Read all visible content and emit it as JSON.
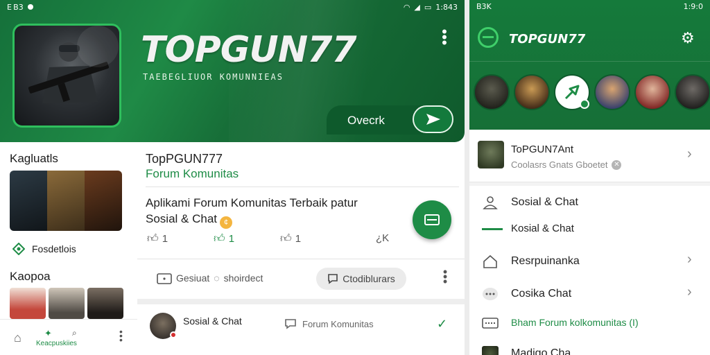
{
  "left": {
    "status_left": "E B3",
    "status_right": "1:843",
    "app_title": "TOPGUN77",
    "app_subtitle": "TAEBEGLIUOR KOMUNNIEAS",
    "cta_label": "Ovecrk",
    "sidebar": {
      "section1_title": "Kagluatls",
      "favorites_label": "Fosdetlois",
      "section2_title": "Kaopoa",
      "bottom_label": "Keacpuskiies"
    },
    "post": {
      "title": "TopPGUN777",
      "subtitle": "Forum Komunitas",
      "body": "Aplikami Forum Komunitas  Terbaik patur Sosial & Chat",
      "coin": "¢",
      "like1": "1",
      "like2": "1",
      "like3": "1",
      "share": "¿K"
    },
    "tabs": {
      "tab_a": "Gesiuat",
      "tab_a2": "shoirdect",
      "tab_b": "Ctodiblurars"
    },
    "feed_row": {
      "title": "Sosial & Chat",
      "forum": "Forum Komunitas"
    }
  },
  "right": {
    "status_left": "B3K",
    "status_right": "1:9:0",
    "brand": "TOPGUN77",
    "profile": {
      "name": "ToPGUN7Ant",
      "sub": "Coolasrs Gnats Gboetet"
    },
    "menu": [
      {
        "label": "Sosial & Chat",
        "icon": "person-icon"
      },
      {
        "label": "Kosial & Chat",
        "icon": "green-bar-icon"
      },
      {
        "label": "Resrpuinanka",
        "icon": "home-icon"
      },
      {
        "label": "Cosika Chat",
        "icon": "chat-bubble-icon"
      },
      {
        "label": "Bham Forum kolkomunitas (I)",
        "icon": "keyboard-icon"
      },
      {
        "label": "Madigo Cha",
        "icon": "thumbnail-icon"
      }
    ]
  },
  "colors": {
    "brand_green": "#1e8c46",
    "dark_green": "#0f5a2c",
    "accent_green": "#3fcf6a"
  }
}
